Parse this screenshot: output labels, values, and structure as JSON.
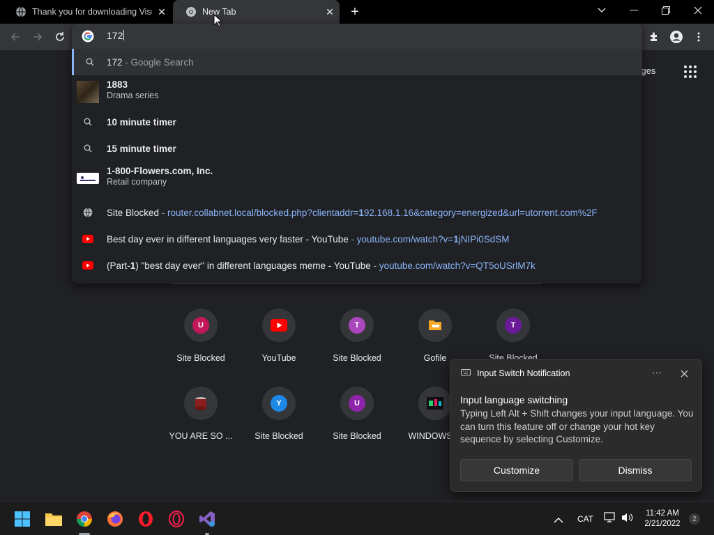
{
  "tabs": [
    {
      "title": "Thank you for downloading Visual Studio",
      "active": false
    },
    {
      "title": "New Tab",
      "active": true
    }
  ],
  "omnibox": {
    "query": "172",
    "suggestions": [
      {
        "kind": "search",
        "main": "172",
        "sep": " - ",
        "detail": "Google Search",
        "selected": true
      },
      {
        "kind": "entity",
        "main": "1883",
        "sub": "Drama series"
      },
      {
        "kind": "search",
        "main": "10 minute timer"
      },
      {
        "kind": "search",
        "main": "15 minute timer"
      },
      {
        "kind": "entity",
        "main": "1-800-Flowers.com, Inc.",
        "sub": "Retail company"
      },
      {
        "kind": "history",
        "main": "Site Blocked",
        "sep": " - ",
        "url_pre": "router.collabnet.local/blocked.php?clientaddr=",
        "url_bold": "1",
        "url_post": "92.168.1.16&category=energized&url=utorrent.com%2F"
      },
      {
        "kind": "youtube",
        "main": "Best day ever in different languages very faster - YouTube",
        "sep": " - ",
        "url_pre": "youtube.com/watch?v=",
        "url_bold": "1",
        "url_post": "jNIPi0SdSM"
      },
      {
        "kind": "youtube",
        "main_pre": "(Part-",
        "main_bold": "1",
        "main_post": ") \"best day ever\" in different languages meme - YouTube",
        "sep": " - ",
        "url_pre": "youtube.com/watch?v=QT5oUSrlM7k",
        "url_bold": "",
        "url_post": ""
      }
    ]
  },
  "page": {
    "images_link_partial": "nages",
    "shortcuts": [
      {
        "label": "Site Blocked",
        "letter": "U",
        "color": "#c2185b"
      },
      {
        "label": "YouTube",
        "letter": "",
        "color": "#ff0000"
      },
      {
        "label": "Site Blocked",
        "letter": "T",
        "color": "#ab47bc"
      },
      {
        "label": "Gofile",
        "letter": "",
        "color": "#f9a825"
      },
      {
        "label": "Site Blocked",
        "letter": "T",
        "color": "#6a1b9a"
      },
      {
        "label": "YOU ARE SO ...",
        "letter": "",
        "color": "#8d1e1e"
      },
      {
        "label": "Site Blocked",
        "letter": "Y",
        "color": "#1e88e5"
      },
      {
        "label": "Site Blocked",
        "letter": "U",
        "color": "#8e24aa"
      },
      {
        "label": "WINDOWS ...",
        "letter": "",
        "color": "#4a148c"
      }
    ]
  },
  "notification": {
    "app": "Input Switch Notification",
    "heading": "Input language switching",
    "body": "Typing Left Alt + Shift changes your input language. You can turn this feature off or change your hot key sequence by selecting Customize.",
    "customize": "Customize",
    "dismiss": "Dismiss"
  },
  "taskbar": {
    "lang": "CAT",
    "time": "11:42 AM",
    "date": "2/21/2022",
    "badge": "2"
  },
  "colors": {
    "accent": "#8ab4f8",
    "bg": "#202124",
    "toolbar": "#35363a"
  }
}
